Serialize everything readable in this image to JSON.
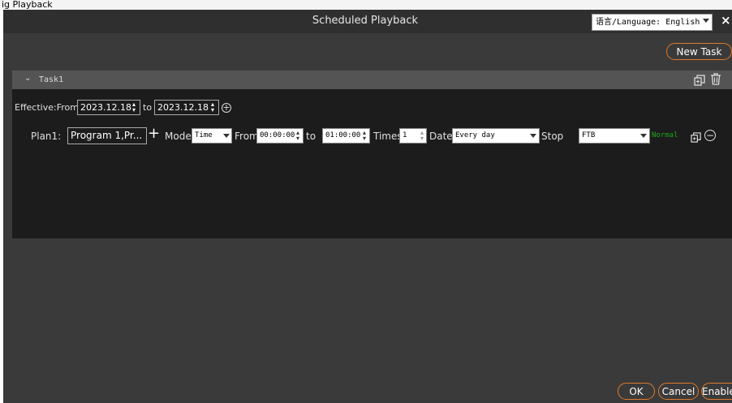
{
  "top_text": "ig Playback",
  "window": {
    "title": "Scheduled Playback",
    "language_select": "语言/Language: English"
  },
  "toolbar": {
    "new_task_label": "New Task"
  },
  "task": {
    "name": "Task1",
    "effective": {
      "label": "Effective:From",
      "from": "2023.12.18",
      "to_label": "to",
      "to": "2023.12.18"
    },
    "plan": {
      "label": "Plan1:",
      "program": "Program 1,Pr...",
      "mode_label": "Mode",
      "mode_value": "Time",
      "from_label": "From",
      "from_time": "00:00:00",
      "to_label": "to",
      "to_time": "01:00:00",
      "times_label": "Times",
      "times_value": "1",
      "date_label": "Date",
      "date_value": "Every day",
      "stop_label": "Stop",
      "stop_value": "FTB",
      "status": "Normal"
    }
  },
  "footer": {
    "ok_label": "OK",
    "cancel_label": "Cancel",
    "enable_label": "Enable"
  },
  "colors": {
    "accent": "#e07a2b",
    "status_normal": "#1aaa1a",
    "dialog_bg": "#3a3a3a",
    "task_body_bg": "#1c1c1c"
  }
}
